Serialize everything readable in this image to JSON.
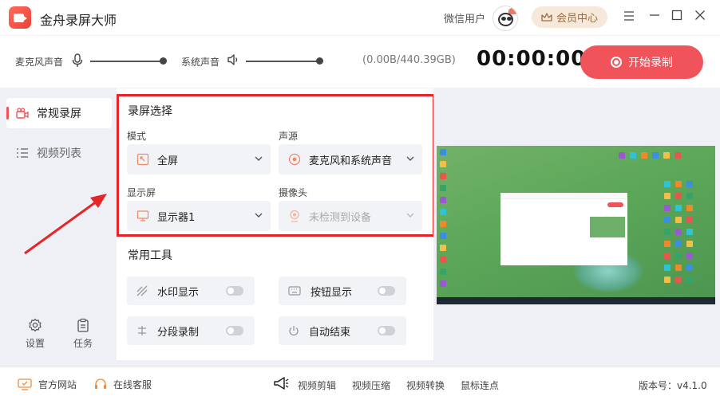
{
  "app": {
    "title": "金舟录屏大师",
    "user_name": "微信用户",
    "vip_label": "会员中心"
  },
  "record_bar": {
    "mic_label": "麦克风声音",
    "system_label": "系统声音",
    "mic_level": 1.0,
    "system_level": 1.0,
    "disk": "(0.00B/440.39GB)",
    "timer": "00:00:00",
    "start_label": "开始录制"
  },
  "sidebar": {
    "items": [
      {
        "label": "常规录屏",
        "icon": "camera-icon",
        "active": true
      },
      {
        "label": "视频列表",
        "icon": "list-icon",
        "active": false
      }
    ],
    "settings_label": "设置",
    "tasks_label": "任务"
  },
  "screen_select": {
    "title": "录屏选择",
    "mode_label": "模式",
    "mode_value": "全屏",
    "audio_label": "声源",
    "audio_value": "麦克风和系统声音",
    "display_label": "显示屏",
    "display_value": "显示器1",
    "camera_label": "摄像头",
    "camera_value": "未检测到设备"
  },
  "tools": {
    "title": "常用工具",
    "items": [
      {
        "label": "水印显示",
        "icon": "watermark-icon",
        "on": false
      },
      {
        "label": "按钮显示",
        "icon": "keyboard-icon",
        "on": false
      },
      {
        "label": "分段录制",
        "icon": "segment-icon",
        "on": false
      },
      {
        "label": "自动结束",
        "icon": "power-icon",
        "on": false
      }
    ]
  },
  "footer": {
    "website": "官方网站",
    "support": "在线客服",
    "tools": [
      "视频剪辑",
      "视频压缩",
      "视频转换",
      "鼠标连点"
    ],
    "version": "版本号：v4.1.0"
  },
  "colors": {
    "accent": "#f0545a",
    "highlight_frame": "#e52528",
    "vip_bg": "#f6e9da"
  }
}
